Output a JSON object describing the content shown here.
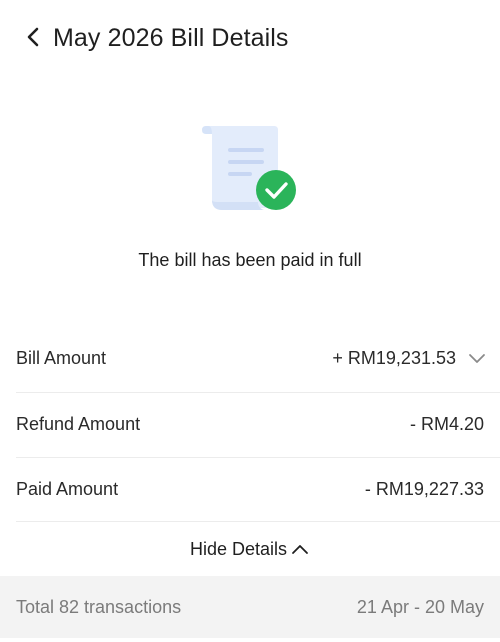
{
  "header": {
    "title": "May 2026 Bill Details"
  },
  "icons": {
    "back": "chevron-left-icon",
    "illustration": "paid-bill-illustration",
    "check": "check-circle-icon",
    "expand": "chevron-down-icon",
    "collapse": "chevron-up-icon"
  },
  "status": {
    "text": "The bill has been paid in full"
  },
  "details": [
    {
      "label": "Bill Amount",
      "value": "+ RM19,231.53"
    },
    {
      "label": "Refund Amount",
      "value": "- RM4.20"
    },
    {
      "label": "Paid Amount",
      "value": "- RM19,227.33"
    }
  ],
  "toggle": {
    "label": "Hide Details"
  },
  "footer": {
    "transactions": "Total 82 transactions",
    "period": "21 Apr - 20 May"
  },
  "colors": {
    "success": "#2bb45a",
    "doc_blue": "#e3ecfb",
    "doc_line": "#c7d6f3"
  }
}
